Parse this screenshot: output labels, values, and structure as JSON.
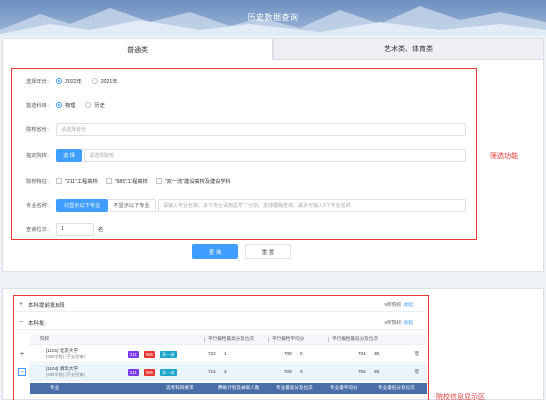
{
  "banner": {
    "title": "历史数据查询"
  },
  "tabs": [
    {
      "label": "普通类"
    },
    {
      "label": "艺术类、体育类"
    }
  ],
  "filters": {
    "year": {
      "label": "选择年份：",
      "options": [
        "2022年",
        "2021年"
      ],
      "selected": "2022年"
    },
    "subject": {
      "label": "首选科目：",
      "options": [
        "物理",
        "历史"
      ],
      "selected": "物理"
    },
    "province": {
      "label": "院校省份：",
      "placeholder": "请选择省份"
    },
    "school": {
      "label": "指定院校：",
      "button": "选 择",
      "placeholder": "请选择院校"
    },
    "features": {
      "label": "院校特征：",
      "options": [
        "\"211\"工程高校",
        "\"985\"工程高校",
        "\"双一流\"建设高校及建设学科"
      ]
    },
    "major": {
      "label": "专业名称：",
      "mode_on": "只显示以下专业",
      "mode_off": "不显示以下专业",
      "placeholder": "请输入专业名称。多个专业请用逗号\",\"分割。支持模糊查询。最多可输入5个专业名称"
    },
    "rank": {
      "label": "查询位次：",
      "value": "1",
      "unit": "名"
    },
    "annotation": "筛选功能"
  },
  "actions": {
    "query": "查 询",
    "reset": "重 置"
  },
  "results": {
    "groups": [
      {
        "sign": "+",
        "label": "本科提前批B段",
        "count": "5所院校",
        "action": "收起"
      },
      {
        "sign": "−",
        "label": "本科批",
        "count": "5所院校",
        "action": "收起"
      }
    ],
    "school_header": [
      "院校",
      "平行报档最高分及位次",
      "平行报档平均分",
      "平行报档最低分及位次"
    ],
    "rows": [
      {
        "sign": "+",
        "code": "[1101] 北京大学",
        "sub": "(985学校)  (不支招锋)",
        "tags": [
          "211",
          "985",
          "双一流"
        ],
        "max": "722",
        "max_rank": "1",
        "avg": "709",
        "avg_rank": "0",
        "min": "704",
        "min_rank": "38"
      },
      {
        "sign": "−",
        "code": "[1104] 清华大学",
        "sub": "(985学校)  (不支招锋)",
        "tags": [
          "211",
          "985",
          "双一流"
        ],
        "max": "714",
        "max_rank": "3",
        "avg": "709",
        "avg_rank": "0",
        "min": "704",
        "min_rank": "38"
      }
    ],
    "major_header": [
      "专业",
      "选考科目要求",
      "腾助计划及录取人数",
      "专业最高分及位次",
      "专业最平均分",
      "专业最低分及位次"
    ],
    "annotation": "院校信息显示区"
  },
  "colors": {
    "accent": "#409eff",
    "annotation": "#e53935",
    "tag211": "#7c3aed",
    "tag985": "#e53935",
    "tagDbl": "#1aa3c9"
  }
}
